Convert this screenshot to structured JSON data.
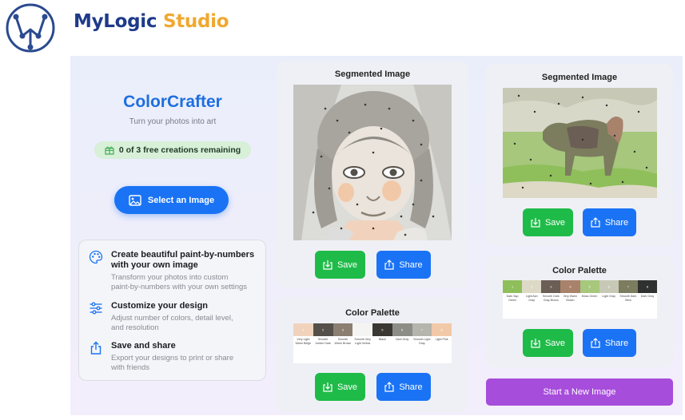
{
  "brand": {
    "part1": "MyLogic",
    "part2": "Studio"
  },
  "app": {
    "title": "ColorCrafter",
    "subtitle": "Turn your photos into art",
    "credits_text": "0 of 3 free creations remaining",
    "select_label": "Select an Image"
  },
  "features": [
    {
      "title_line1": "Create beautiful paint-by-numbers",
      "title_line2": "with your own image",
      "desc_line1": "Transform your photos into custom",
      "desc_line2": "paint-by-numbers with your own settings",
      "icon": "palette-icon"
    },
    {
      "title_line1": "Customize your design",
      "desc_line1": "Adjust number of colors, detail level,",
      "desc_line2": "and resolution",
      "icon": "sliders-icon"
    },
    {
      "title_line1": "Save and share",
      "desc_line1": "Export your designs to print or share",
      "desc_line2": "with friends",
      "icon": "share-icon"
    }
  ],
  "middle": {
    "segmented_title": "Segmented Image",
    "palette_title": "Color Palette",
    "save_label": "Save",
    "share_label": "Share",
    "palette": [
      {
        "color": "#f1d3bd",
        "num": "1",
        "label": "Very Light Warm Beige"
      },
      {
        "color": "#55514a",
        "num": "2",
        "label": "Smooth Umber Dark"
      },
      {
        "color": "#8a7f71",
        "num": "3",
        "label": "Smooth Warm Brown"
      },
      {
        "color": "#f4f4f2",
        "num": "4",
        "label": "Smooth Very Light Vellow"
      },
      {
        "color": "#3b3833",
        "num": "5",
        "label": "Black"
      },
      {
        "color": "#8d8d88",
        "num": "6",
        "label": "Dark Gray"
      },
      {
        "color": "#b5b4ad",
        "num": "7",
        "label": "Smooth Light Gray"
      },
      {
        "color": "#f2c9a8",
        "num": "8",
        "label": "Light Pink"
      }
    ]
  },
  "right": {
    "segmented_title": "Segmented Image",
    "palette_title": "Color Palette",
    "save_label": "Save",
    "share_label": "Share",
    "start_label": "Start a New Image",
    "palette": [
      {
        "color": "#8fbf5a",
        "num": "1",
        "label": "Dark Sap Green"
      },
      {
        "color": "#ddd9c6",
        "num": "2",
        "label": "Light Ash Gray"
      },
      {
        "color": "#6a5e55",
        "num": "3",
        "label": "Smooth Dark Gray Brown"
      },
      {
        "color": "#a9826c",
        "num": "4",
        "label": "Very Warm Brown"
      },
      {
        "color": "#a6c77c",
        "num": "5",
        "label": "Moss Green"
      },
      {
        "color": "#c7c9b6",
        "num": "6",
        "label": "Light Gray"
      },
      {
        "color": "#7c7c5e",
        "num": "7",
        "label": "Smooth Dark Olive"
      },
      {
        "color": "#2f3030",
        "num": "8",
        "label": "Dark Gray"
      }
    ]
  }
}
